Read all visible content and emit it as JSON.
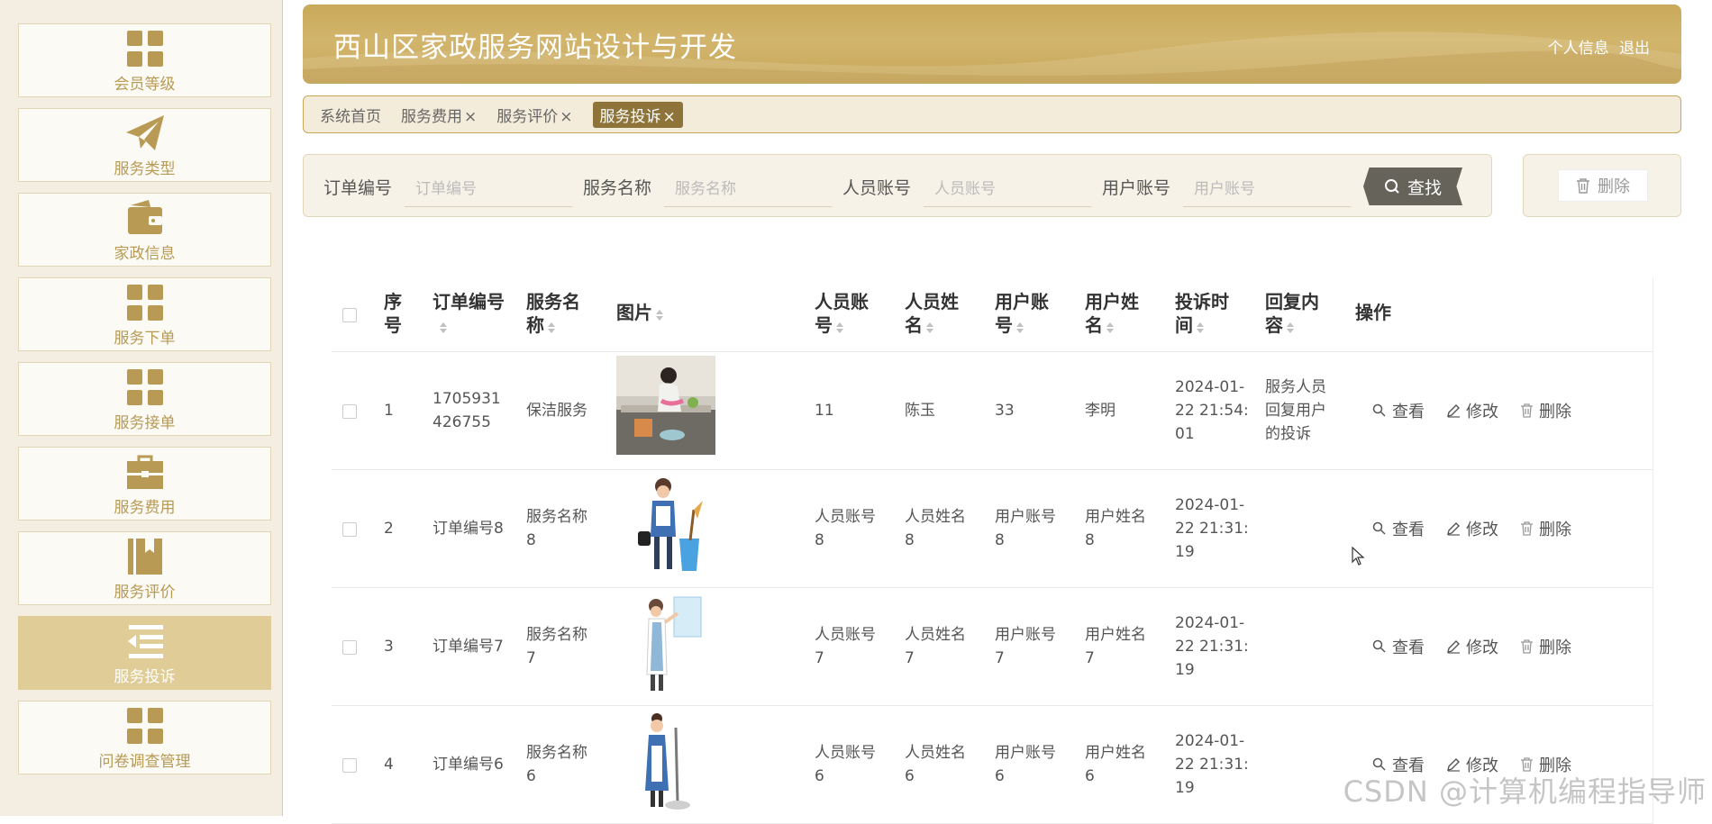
{
  "sidebar": {
    "items": [
      {
        "label": "会员等级",
        "icon": "grid-icon"
      },
      {
        "label": "服务类型",
        "icon": "paper-plane-icon"
      },
      {
        "label": "家政信息",
        "icon": "wallet-icon"
      },
      {
        "label": "服务下单",
        "icon": "grid-icon"
      },
      {
        "label": "服务接单",
        "icon": "grid-icon"
      },
      {
        "label": "服务费用",
        "icon": "briefcase-icon"
      },
      {
        "label": "服务评价",
        "icon": "bookmark-book-icon"
      },
      {
        "label": "服务投诉",
        "icon": "list-indent-icon"
      },
      {
        "label": "问卷调查管理",
        "icon": "grid-icon"
      }
    ],
    "active_index": 7
  },
  "header": {
    "title": "西山区家政服务网站设计与开发",
    "profile": "个人信息",
    "logout": "退出"
  },
  "tabs": [
    {
      "label": "系统首页",
      "closable": false
    },
    {
      "label": "服务费用",
      "closable": true
    },
    {
      "label": "服务评价",
      "closable": true
    },
    {
      "label": "服务投诉",
      "closable": true,
      "active": true
    }
  ],
  "tab_close": "×",
  "search": {
    "fields": [
      {
        "label": "订单编号",
        "placeholder": "订单编号"
      },
      {
        "label": "服务名称",
        "placeholder": "服务名称"
      },
      {
        "label": "人员账号",
        "placeholder": "人员账号"
      },
      {
        "label": "用户账号",
        "placeholder": "用户账号"
      }
    ],
    "button": "查找",
    "delete_button": "删除"
  },
  "table": {
    "headers": {
      "index": [
        "序",
        "号"
      ],
      "order": [
        "订单编号"
      ],
      "service": [
        "服务名",
        "称"
      ],
      "image": [
        "图片"
      ],
      "staff_acc": [
        "人员账",
        "号"
      ],
      "staff_name": [
        "人员姓",
        "名"
      ],
      "user_acc": [
        "用户账",
        "号"
      ],
      "user_name": [
        "用户姓",
        "名"
      ],
      "time": [
        "投诉时",
        "间"
      ],
      "reply": [
        "回复内",
        "容"
      ],
      "ops": [
        "操作"
      ]
    },
    "rows": [
      {
        "index": "1",
        "order": [
          "1705931",
          "426755"
        ],
        "service": [
          "保洁服务"
        ],
        "image": "photo-cleaning",
        "staff_acc": [
          "11"
        ],
        "staff_name": [
          "陈玉"
        ],
        "user_acc": [
          "33"
        ],
        "user_name": [
          "李明"
        ],
        "time": [
          "2024-01-",
          "22 21:54:",
          "01"
        ],
        "reply": [
          "服务人员",
          "回复用户",
          "的投诉"
        ]
      },
      {
        "index": "2",
        "order": [
          "订单编号8"
        ],
        "service": [
          "服务名称",
          "8"
        ],
        "image": "cleaner-bucket-illustration",
        "staff_acc": [
          "人员账号",
          "8"
        ],
        "staff_name": [
          "人员姓名",
          "8"
        ],
        "user_acc": [
          "用户账号",
          "8"
        ],
        "user_name": [
          "用户姓名",
          "8"
        ],
        "time": [
          "2024-01-",
          "22 21:31:",
          "19"
        ],
        "reply": []
      },
      {
        "index": "3",
        "order": [
          "订单编号7"
        ],
        "service": [
          "服务名称",
          "7"
        ],
        "image": "cleaner-window-illustration",
        "staff_acc": [
          "人员账号",
          "7"
        ],
        "staff_name": [
          "人员姓名",
          "7"
        ],
        "user_acc": [
          "用户账号",
          "7"
        ],
        "user_name": [
          "用户姓名",
          "7"
        ],
        "time": [
          "2024-01-",
          "22 21:31:",
          "19"
        ],
        "reply": []
      },
      {
        "index": "4",
        "order": [
          "订单编号6"
        ],
        "service": [
          "服务名称",
          "6"
        ],
        "image": "cleaner-mop-illustration",
        "staff_acc": [
          "人员账号",
          "6"
        ],
        "staff_name": [
          "人员姓名",
          "6"
        ],
        "user_acc": [
          "用户账号",
          "6"
        ],
        "user_name": [
          "用户姓名",
          "6"
        ],
        "time": [
          "2024-01-",
          "22 21:31:",
          "19"
        ],
        "reply": []
      }
    ],
    "ops": {
      "view": "查看",
      "edit": "修改",
      "delete": "删除"
    }
  },
  "watermark": "CSDN @计算机编程指导师",
  "colors": {
    "accent": "#c7a75a",
    "active_sidebar": "#dfcc96",
    "active_tab": "#8e7438",
    "search_button": "#66635b"
  }
}
